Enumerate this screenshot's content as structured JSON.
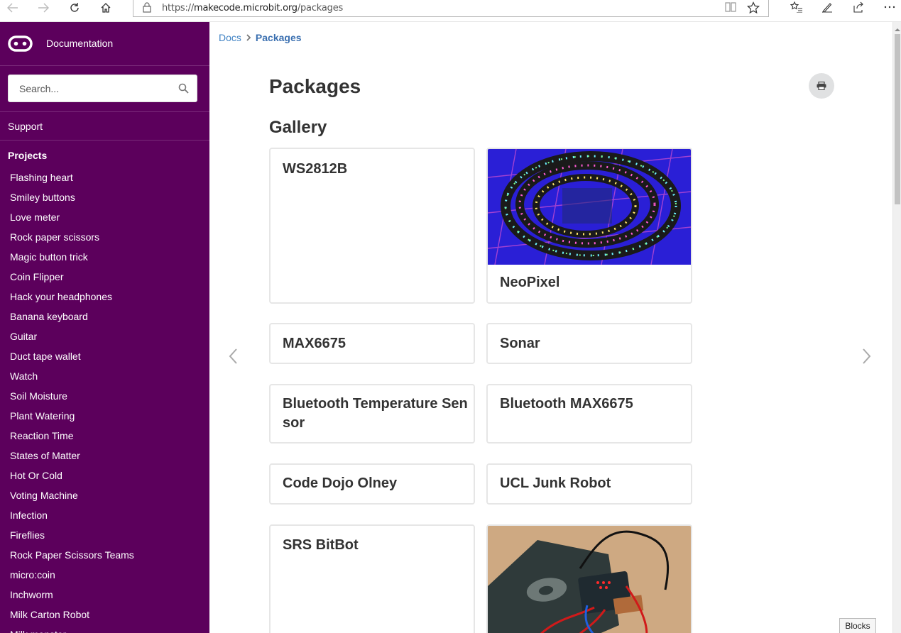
{
  "browser": {
    "url_prefix": "https://",
    "url_host": "makecode.microbit.org",
    "url_path": "/packages",
    "icons": [
      "back-icon",
      "forward-icon",
      "refresh-icon",
      "home-icon",
      "lock-icon",
      "reading-view-icon",
      "favorite-star-icon",
      "favorites-hub-icon",
      "pen-icon",
      "share-icon",
      "more-icon"
    ]
  },
  "sidebar": {
    "title": "Documentation",
    "search_placeholder": "Search...",
    "support_label": "Support",
    "section_heading": "Projects",
    "items": [
      "Flashing heart",
      "Smiley buttons",
      "Love meter",
      "Rock paper scissors",
      "Magic button trick",
      "Coin Flipper",
      "Hack your headphones",
      "Banana keyboard",
      "Guitar",
      "Duct tape wallet",
      "Watch",
      "Soil Moisture",
      "Plant Watering",
      "Reaction Time",
      "States of Matter",
      "Hot Or Cold",
      "Voting Machine",
      "Infection",
      "Fireflies",
      "Rock Paper Scissors Teams",
      "micro:coin",
      "Inchworm",
      "Milk Carton Robot",
      "Milk monster"
    ]
  },
  "breadcrumb": {
    "root": "Docs",
    "current": "Packages"
  },
  "page": {
    "title": "Packages",
    "section": "Gallery"
  },
  "cards": [
    {
      "title": "WS2812B"
    },
    {
      "title": "NeoPixel"
    },
    {
      "title": "MAX6675"
    },
    {
      "title": "Sonar"
    },
    {
      "title": "Bluetooth Temperature Sensor"
    },
    {
      "title": "Bluetooth MAX6675"
    },
    {
      "title": "Code Dojo Olney"
    },
    {
      "title": "UCL Junk Robot"
    },
    {
      "title": "SRS BitBot"
    },
    {
      "title": ""
    }
  ],
  "footer": {
    "blocks_label": "Blocks"
  },
  "colors": {
    "sidebar_bg": "#5c005c",
    "link": "#4183c4"
  }
}
